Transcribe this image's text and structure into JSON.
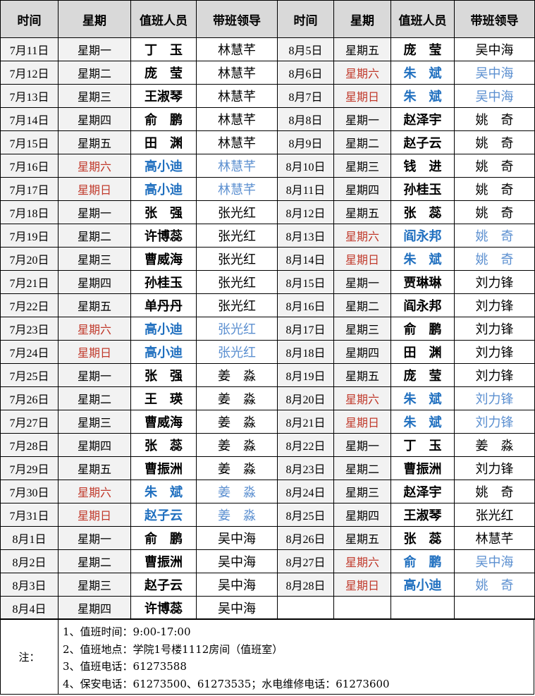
{
  "headers": [
    "时间",
    "星期",
    "值班人员",
    "带班领导",
    "时间",
    "星期",
    "值班人员",
    "带班领导"
  ],
  "rows": [
    {
      "l": {
        "date": "7月11日",
        "day": "星期一",
        "person": "丁　玉",
        "leader": "林慧芊",
        "we": false
      },
      "r": {
        "date": "8月5日",
        "day": "星期五",
        "person": "庞　莹",
        "leader": "吴中海",
        "we": false
      }
    },
    {
      "l": {
        "date": "7月12日",
        "day": "星期二",
        "person": "庞　莹",
        "leader": "林慧芊",
        "we": false
      },
      "r": {
        "date": "8月6日",
        "day": "星期六",
        "person": "朱　斌",
        "leader": "吴中海",
        "we": true
      }
    },
    {
      "l": {
        "date": "7月13日",
        "day": "星期三",
        "person": "王淑琴",
        "leader": "林慧芊",
        "we": false
      },
      "r": {
        "date": "8月7日",
        "day": "星期日",
        "person": "朱　斌",
        "leader": "吴中海",
        "we": true
      }
    },
    {
      "l": {
        "date": "7月14日",
        "day": "星期四",
        "person": "俞　鹏",
        "leader": "林慧芊",
        "we": false
      },
      "r": {
        "date": "8月8日",
        "day": "星期一",
        "person": "赵泽宇",
        "leader": "姚　奇",
        "we": false
      }
    },
    {
      "l": {
        "date": "7月15日",
        "day": "星期五",
        "person": "田　渊",
        "leader": "林慧芊",
        "we": false
      },
      "r": {
        "date": "8月9日",
        "day": "星期二",
        "person": "赵子云",
        "leader": "姚　奇",
        "we": false
      }
    },
    {
      "l": {
        "date": "7月16日",
        "day": "星期六",
        "person": "高小迪",
        "leader": "林慧芊",
        "we": true
      },
      "r": {
        "date": "8月10日",
        "day": "星期三",
        "person": "钱　进",
        "leader": "姚　奇",
        "we": false
      }
    },
    {
      "l": {
        "date": "7月17日",
        "day": "星期日",
        "person": "高小迪",
        "leader": "林慧芊",
        "we": true
      },
      "r": {
        "date": "8月11日",
        "day": "星期四",
        "person": "孙桂玉",
        "leader": "姚　奇",
        "we": false
      }
    },
    {
      "l": {
        "date": "7月18日",
        "day": "星期一",
        "person": "张　强",
        "leader": "张光红",
        "we": false
      },
      "r": {
        "date": "8月12日",
        "day": "星期五",
        "person": "张　蕊",
        "leader": "姚　奇",
        "we": false
      }
    },
    {
      "l": {
        "date": "7月19日",
        "day": "星期二",
        "person": "许博蕊",
        "leader": "张光红",
        "we": false
      },
      "r": {
        "date": "8月13日",
        "day": "星期六",
        "person": "阎永邦",
        "leader": "姚　奇",
        "we": true
      }
    },
    {
      "l": {
        "date": "7月20日",
        "day": "星期三",
        "person": "曹威海",
        "leader": "张光红",
        "we": false
      },
      "r": {
        "date": "8月14日",
        "day": "星期日",
        "person": "朱　斌",
        "leader": "姚　奇",
        "we": true
      }
    },
    {
      "l": {
        "date": "7月21日",
        "day": "星期四",
        "person": "孙桂玉",
        "leader": "张光红",
        "we": false
      },
      "r": {
        "date": "8月15日",
        "day": "星期一",
        "person": "贾琳琳",
        "leader": "刘力锋",
        "we": false
      }
    },
    {
      "l": {
        "date": "7月22日",
        "day": "星期五",
        "person": "单丹丹",
        "leader": "张光红",
        "we": false
      },
      "r": {
        "date": "8月16日",
        "day": "星期二",
        "person": "阎永邦",
        "leader": "刘力锋",
        "we": false
      }
    },
    {
      "l": {
        "date": "7月23日",
        "day": "星期六",
        "person": "高小迪",
        "leader": "张光红",
        "we": true
      },
      "r": {
        "date": "8月17日",
        "day": "星期三",
        "person": "俞　鹏",
        "leader": "刘力锋",
        "we": false
      }
    },
    {
      "l": {
        "date": "7月24日",
        "day": "星期日",
        "person": "高小迪",
        "leader": "张光红",
        "we": true
      },
      "r": {
        "date": "8月18日",
        "day": "星期四",
        "person": "田　渊",
        "leader": "刘力锋",
        "we": false
      }
    },
    {
      "l": {
        "date": "7月25日",
        "day": "星期一",
        "person": "张　强",
        "leader": "姜　淼",
        "we": false
      },
      "r": {
        "date": "8月19日",
        "day": "星期五",
        "person": "庞　莹",
        "leader": "刘力锋",
        "we": false
      }
    },
    {
      "l": {
        "date": "7月26日",
        "day": "星期二",
        "person": "王　瑛",
        "leader": "姜　淼",
        "we": false
      },
      "r": {
        "date": "8月20日",
        "day": "星期六",
        "person": "朱　斌",
        "leader": "刘力锋",
        "we": true
      }
    },
    {
      "l": {
        "date": "7月27日",
        "day": "星期三",
        "person": "曹威海",
        "leader": "姜　淼",
        "we": false
      },
      "r": {
        "date": "8月21日",
        "day": "星期日",
        "person": "朱　斌",
        "leader": "刘力锋",
        "we": true
      }
    },
    {
      "l": {
        "date": "7月28日",
        "day": "星期四",
        "person": "张　蕊",
        "leader": "姜　淼",
        "we": false
      },
      "r": {
        "date": "8月22日",
        "day": "星期一",
        "person": "丁　玉",
        "leader": "姜　淼",
        "we": false
      }
    },
    {
      "l": {
        "date": "7月29日",
        "day": "星期五",
        "person": "曹振洲",
        "leader": "姜　淼",
        "we": false
      },
      "r": {
        "date": "8月23日",
        "day": "星期二",
        "person": "曹振洲",
        "leader": "刘力锋",
        "we": false
      }
    },
    {
      "l": {
        "date": "7月30日",
        "day": "星期六",
        "person": "朱　斌",
        "leader": "姜　淼",
        "we": true
      },
      "r": {
        "date": "8月24日",
        "day": "星期三",
        "person": "赵泽宇",
        "leader": "姚　奇",
        "we": false
      }
    },
    {
      "l": {
        "date": "7月31日",
        "day": "星期日",
        "person": "赵子云",
        "leader": "姜　淼",
        "we": true
      },
      "r": {
        "date": "8月25日",
        "day": "星期四",
        "person": "王淑琴",
        "leader": "张光红",
        "we": false
      }
    },
    {
      "l": {
        "date": "8月1日",
        "day": "星期一",
        "person": "俞　鹏",
        "leader": "吴中海",
        "we": false
      },
      "r": {
        "date": "8月26日",
        "day": "星期五",
        "person": "张　蕊",
        "leader": "林慧芊",
        "we": false
      }
    },
    {
      "l": {
        "date": "8月2日",
        "day": "星期二",
        "person": "曹振洲",
        "leader": "吴中海",
        "we": false
      },
      "r": {
        "date": "8月27日",
        "day": "星期六",
        "person": "俞　鹏",
        "leader": "吴中海",
        "we": true
      }
    },
    {
      "l": {
        "date": "8月3日",
        "day": "星期三",
        "person": "赵子云",
        "leader": "吴中海",
        "we": false
      },
      "r": {
        "date": "8月28日",
        "day": "星期日",
        "person": "高小迪",
        "leader": "姚　奇",
        "we": true
      }
    },
    {
      "l": {
        "date": "8月4日",
        "day": "星期四",
        "person": "许博蕊",
        "leader": "吴中海",
        "we": false
      },
      "r": null
    }
  ],
  "notes": {
    "label": "注：",
    "lines": [
      "1、值班时间：9:00-17:00",
      "2、值班地点：学院1号楼1112房间（值班室）",
      "3、值班电话：61273588",
      "4、保安电话：61273500、61273535；水电维修电话：61273600"
    ]
  },
  "colors": {
    "header_bg": "#d9d9d9",
    "weekend_day": "#c0392b",
    "weekend_person": "#1f6fbf",
    "weekend_leader": "#5b8fd0"
  }
}
